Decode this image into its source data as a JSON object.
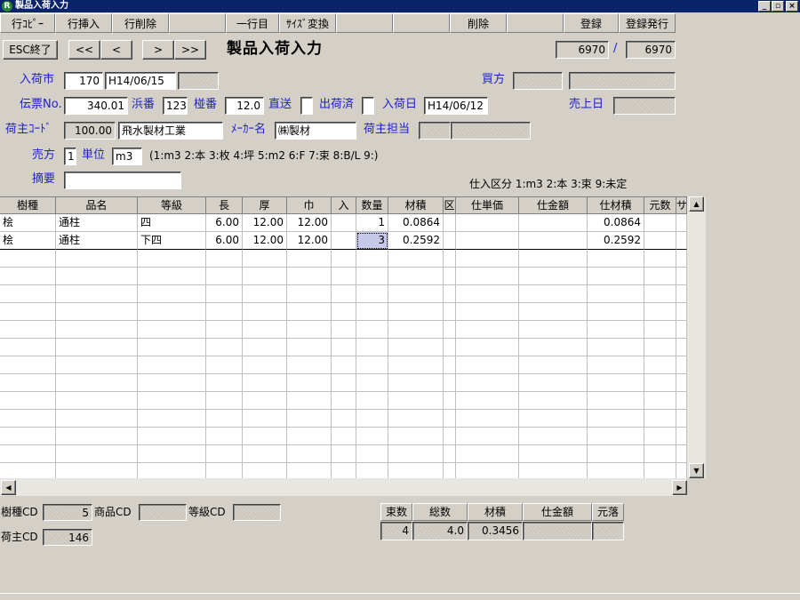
{
  "window": {
    "title": "製品入荷入力",
    "icon_letter": "R",
    "min": "_",
    "max": "▫",
    "close": "×"
  },
  "toolbar": {
    "row_copy": "行ｺﾋﾟｰ",
    "row_insert": "行挿入",
    "row_delete": "行削除",
    "one_row": "一行目",
    "size_convert": "ｻｲｽﾞ変換",
    "delete": "削除",
    "register": "登録",
    "register_issue": "登録発行"
  },
  "nav": {
    "esc": "ESC終了",
    "first": "<<",
    "prev": "<",
    "next": ">",
    "last": ">>",
    "page_title": "製品入荷入力",
    "record_current": "6970",
    "record_sep": "/",
    "record_total": "6970"
  },
  "form": {
    "market_label": "入荷市",
    "market_code": "170",
    "market_date": "H14/06/15",
    "buyer_label": "買方",
    "slip_label": "伝票No.",
    "slip_no": "340.01",
    "hama_label": "浜番",
    "hama_no": "123",
    "hai_label": "椪番",
    "hai_no": "12.0",
    "direct_label": "直送",
    "shipped_label": "出荷済",
    "arrival_label": "入荷日",
    "arrival_date": "H14/06/12",
    "sale_date_label": "売上日",
    "shipper_code_label": "荷主ｺｰﾄﾞ",
    "shipper_code": "100.00",
    "shipper_name": "飛水製材工業",
    "maker_label": "ﾒｰｶｰ名",
    "maker_name": "㈱製材",
    "shipper_staff_label": "荷主担当",
    "seller_label": "売方",
    "seller_value": "1",
    "unit_label": "単位",
    "unit_value": "m3",
    "unit_legend": "(1:m3 2:本 3:枚 4:坪 5:m2 6:F 7:束 8:B/L 9:)",
    "memo_label": "摘要",
    "purchase_legend": "仕入区分 1:m3 2:本 3:束 9:未定"
  },
  "grid": {
    "headers": [
      "樹種",
      "品名",
      "等級",
      "長",
      "厚",
      "巾",
      "入",
      "数量",
      "材積",
      "区",
      "仕単価",
      "仕金額",
      "仕材積",
      "元数",
      "サ"
    ],
    "rows": [
      [
        "桧",
        "通柱",
        "四",
        "6.00",
        "12.00",
        "12.00",
        "",
        "1",
        "0.0864",
        "",
        "",
        "",
        "0.0864",
        "",
        ""
      ],
      [
        "桧",
        "通柱",
        "下四",
        "6.00",
        "12.00",
        "12.00",
        "",
        "3",
        "0.2592",
        "",
        "",
        "",
        "0.2592",
        "",
        ""
      ]
    ]
  },
  "footer": {
    "species_cd_label": "樹種CD",
    "species_cd": "5",
    "product_cd_label": "商品CD",
    "grade_cd_label": "等級CD",
    "shipper_cd_label": "荷主CD",
    "shipper_cd": "146",
    "summary_headers": [
      "束数",
      "総数",
      "材積",
      "仕金額",
      "元落"
    ],
    "summary_values": [
      "4",
      "4.0",
      "0.3456",
      "",
      ""
    ]
  }
}
